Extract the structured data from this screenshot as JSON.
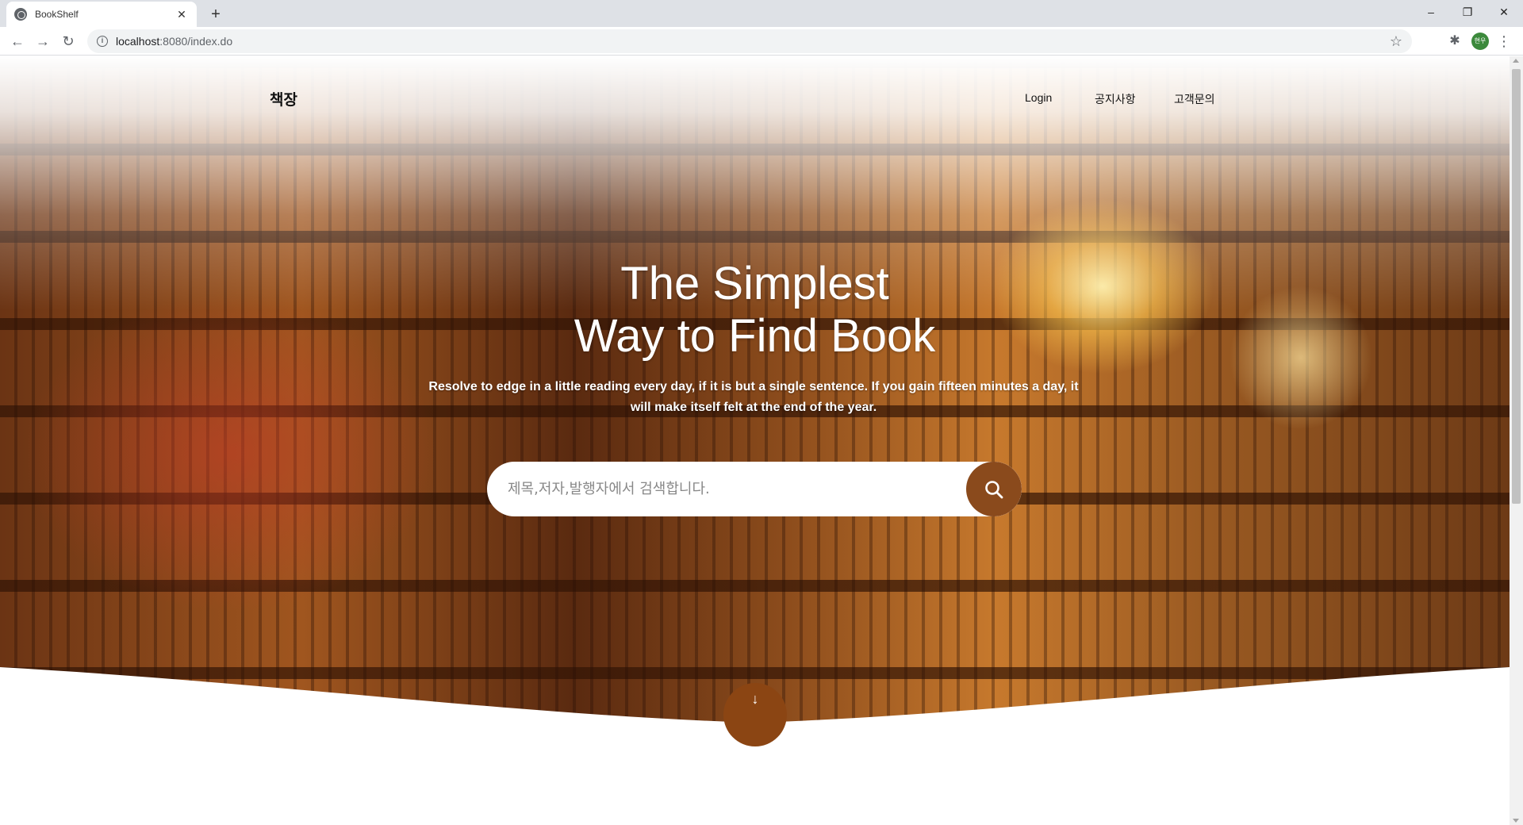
{
  "browser": {
    "tab_title": "BookShelf",
    "url_host": "localhost",
    "url_rest": ":8080/index.do",
    "window_controls": {
      "minimize": "–",
      "restore": "❐",
      "close": "✕"
    },
    "new_tab": "+",
    "profile_initials": "현우"
  },
  "site": {
    "brand": "책장",
    "nav": {
      "login": "Login",
      "notice": "공지사항",
      "inquiry": "고객문의"
    }
  },
  "hero": {
    "title_line1": "The Simplest",
    "title_line2": "Way to Find Book",
    "subtitle": "Resolve to edge in a little reading every day, if it is but a single sentence. If you gain fifteen minutes a day, it will make itself felt at the end of the year.",
    "search_placeholder": "제목,저자,발행자에서 검색합니다.",
    "scroll_down": "↓"
  },
  "colors": {
    "accent": "#8b4513",
    "search_button": "#8a4a1c",
    "chrome_bg": "#dee1e6"
  },
  "icons": [
    "globe-icon",
    "close-icon",
    "back-icon",
    "forward-icon",
    "reload-icon",
    "info-icon",
    "star-icon",
    "extensions-icon",
    "menu-icon",
    "search-icon",
    "arrow-down-icon"
  ]
}
